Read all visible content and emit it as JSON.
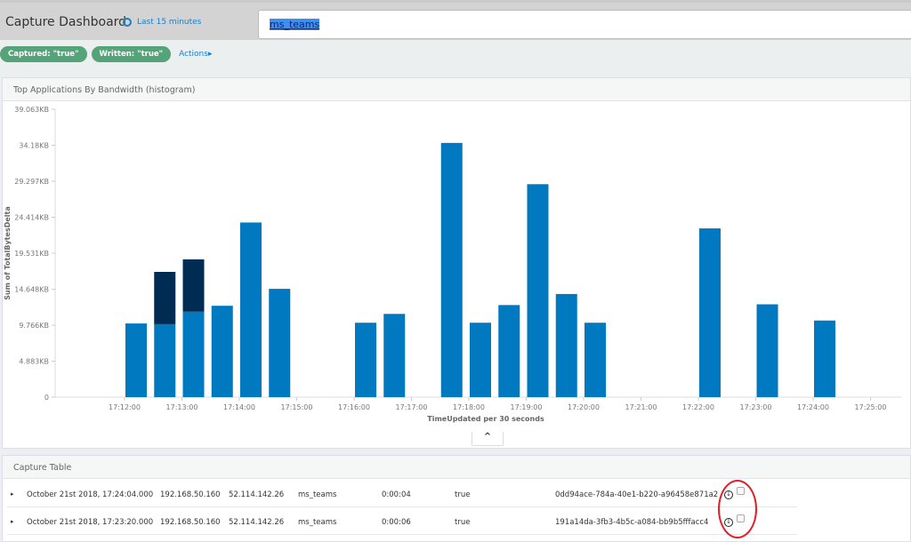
{
  "header": {
    "title": "Capture Dashboard",
    "time_range": "Last 15 minutes",
    "search_value": "ms_teams"
  },
  "filters": [
    {
      "label": "Captured: \"true\""
    },
    {
      "label": "Written: \"true\""
    }
  ],
  "actions_label": "Actions",
  "chart_panel": {
    "title": "Top Applications By Bandwidth (histogram)"
  },
  "chart_data": {
    "type": "bar",
    "stacked": true,
    "xlabel": "TimeUpdated per 30 seconds",
    "ylabel": "Sum of TotalBytesDelta",
    "y_ticks": [
      "0",
      "4.883KB",
      "9.766KB",
      "14.648KB",
      "19.531KB",
      "24.414KB",
      "29.297KB",
      "34.18KB",
      "39.063KB"
    ],
    "ylim": [
      0,
      39.063
    ],
    "x_ticks": [
      "17:12:00",
      "17:13:00",
      "17:14:00",
      "17:15:00",
      "17:16:00",
      "17:17:00",
      "17:18:00",
      "17:19:00",
      "17:20:00",
      "17:21:00",
      "17:22:00",
      "17:23:00",
      "17:24:00",
      "17:25:00"
    ],
    "colors": [
      "#0079c1",
      "#002b52"
    ],
    "bins": [
      {
        "x": "17:12:00",
        "values": [
          10.0,
          0
        ]
      },
      {
        "x": "17:12:30",
        "values": [
          9.9,
          7.1
        ]
      },
      {
        "x": "17:13:00",
        "values": [
          11.6,
          7.1
        ]
      },
      {
        "x": "17:13:30",
        "values": [
          12.4,
          0
        ]
      },
      {
        "x": "17:14:00",
        "values": [
          23.7,
          0
        ]
      },
      {
        "x": "17:14:30",
        "values": [
          14.7,
          0
        ]
      },
      {
        "x": "17:16:00",
        "values": [
          10.1,
          0
        ]
      },
      {
        "x": "17:16:30",
        "values": [
          11.3,
          0
        ]
      },
      {
        "x": "17:17:30",
        "values": [
          34.5,
          0
        ]
      },
      {
        "x": "17:18:00",
        "values": [
          10.1,
          0
        ]
      },
      {
        "x": "17:18:30",
        "values": [
          12.5,
          0
        ]
      },
      {
        "x": "17:19:00",
        "values": [
          28.9,
          0
        ]
      },
      {
        "x": "17:19:30",
        "values": [
          14.0,
          0
        ]
      },
      {
        "x": "17:20:00",
        "values": [
          10.1,
          0
        ]
      },
      {
        "x": "17:22:00",
        "values": [
          22.9,
          0
        ]
      },
      {
        "x": "17:23:00",
        "values": [
          12.6,
          0
        ]
      },
      {
        "x": "17:24:00",
        "values": [
          10.4,
          0
        ]
      }
    ]
  },
  "table": {
    "title": "Capture Table",
    "rows": [
      {
        "time": "October 21st 2018, 17:24:04.000",
        "src": "192.168.50.160",
        "dst": "52.114.142.26",
        "app": "ms_teams",
        "duration": "0:00:04",
        "captured": "true",
        "id": "0dd94ace-784a-40e1-b220-a96458e871a2"
      },
      {
        "time": "October 21st 2018, 17:23:20.000",
        "src": "192.168.50.160",
        "dst": "52.114.142.26",
        "app": "ms_teams",
        "duration": "0:00:06",
        "captured": "true",
        "id": "191a14da-3fb3-4b5c-a084-bb9b5fffacc4"
      }
    ]
  }
}
